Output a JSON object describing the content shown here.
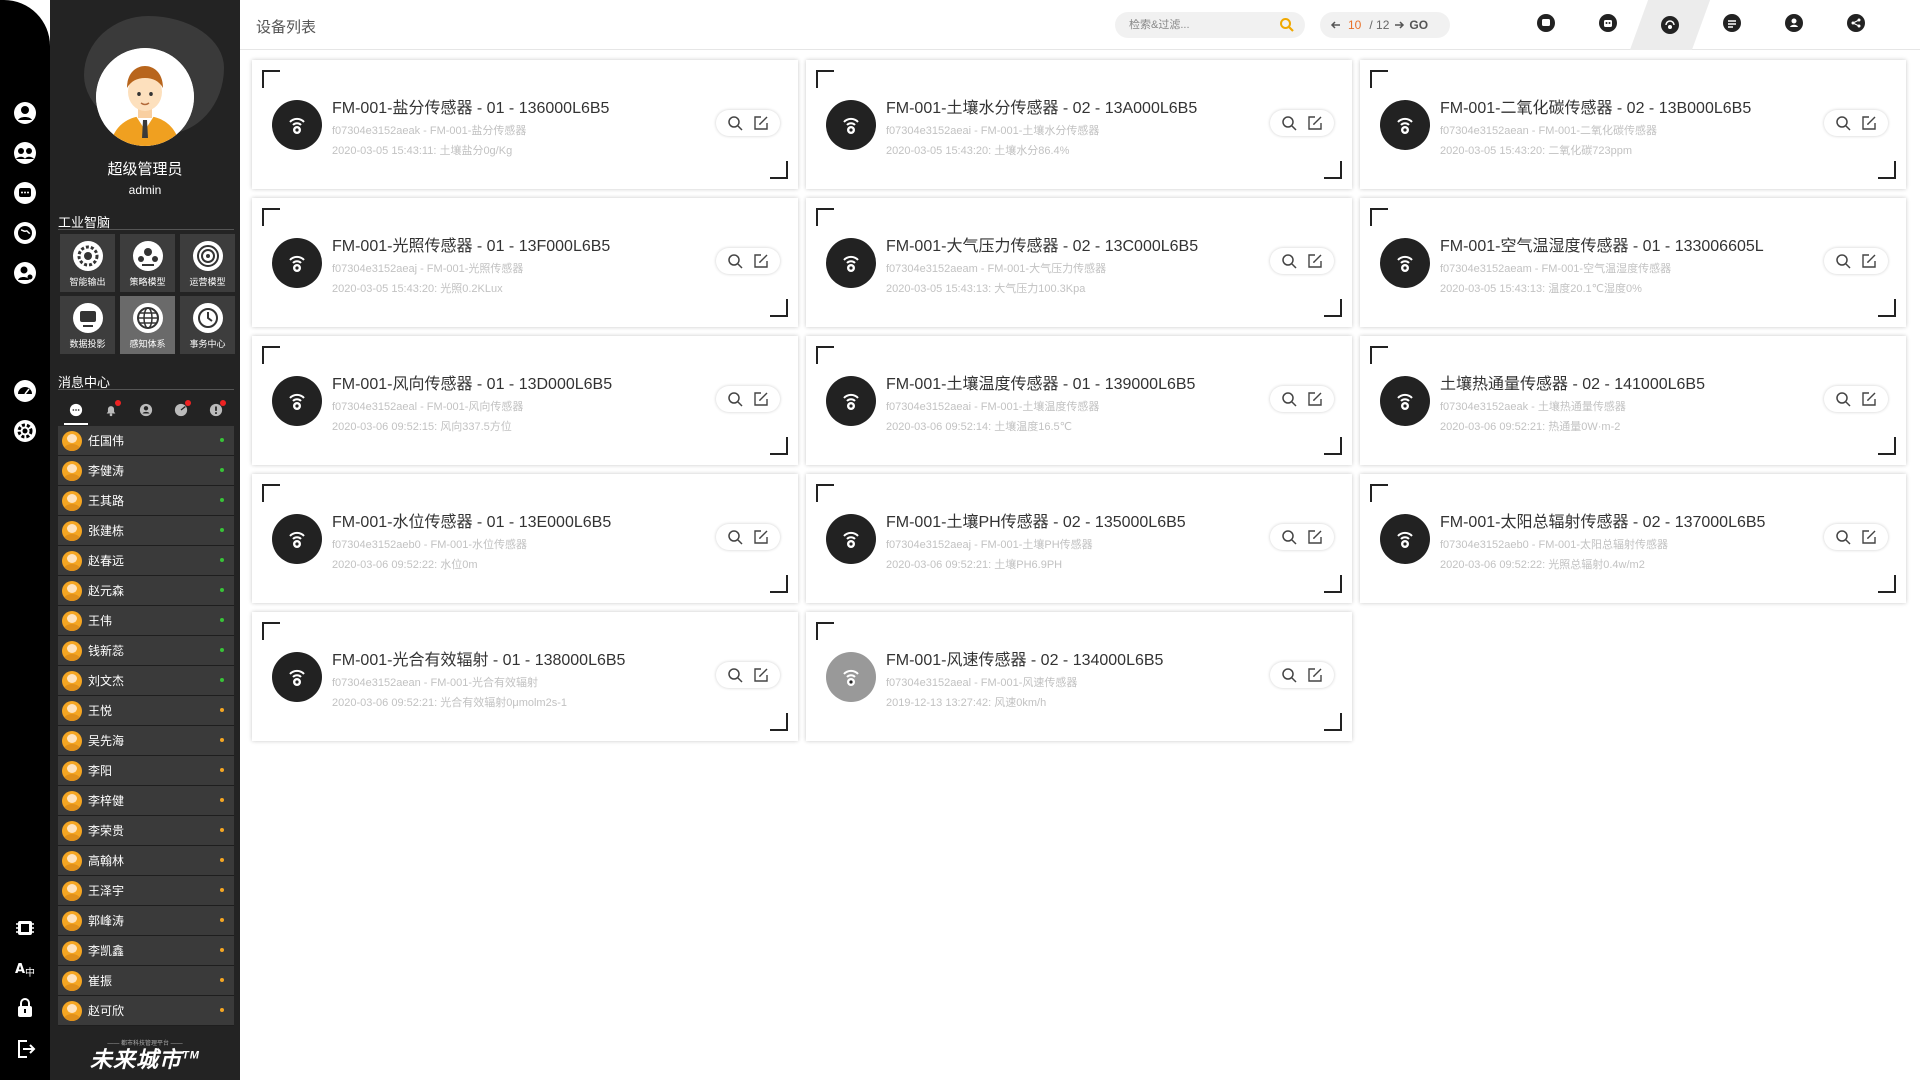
{
  "page_title": "设备列表",
  "search": {
    "placeholder": "检索&过滤..."
  },
  "pager": {
    "current": "10",
    "total": "/ 12",
    "go": "GO"
  },
  "profile": {
    "display_name": "超级管理员",
    "account": "admin"
  },
  "section_industry": "工业智脑",
  "modules": [
    {
      "label": "智能输出",
      "icon": "gear-icon",
      "active": false
    },
    {
      "label": "策略模型",
      "icon": "model-icon",
      "active": false
    },
    {
      "label": "运营模型",
      "icon": "operation-icon",
      "active": false
    },
    {
      "label": "数据投影",
      "icon": "projection-icon",
      "active": false
    },
    {
      "label": "感知体系",
      "icon": "globe-icon",
      "active": true
    },
    {
      "label": "事务中心",
      "icon": "affair-icon",
      "active": false
    }
  ],
  "section_messages": "消息中心",
  "contacts": [
    {
      "name": "任国伟",
      "status": "online"
    },
    {
      "name": "李健涛",
      "status": "online"
    },
    {
      "name": "王其路",
      "status": "online"
    },
    {
      "name": "张建栋",
      "status": "online"
    },
    {
      "name": "赵春远",
      "status": "online"
    },
    {
      "name": "赵元森",
      "status": "online"
    },
    {
      "name": "王伟",
      "status": "online"
    },
    {
      "name": "钱新蕊",
      "status": "online"
    },
    {
      "name": "刘文杰",
      "status": "online"
    },
    {
      "name": "王悦",
      "status": "away"
    },
    {
      "name": "吴先海",
      "status": "away"
    },
    {
      "name": "李阳",
      "status": "away"
    },
    {
      "name": "李梓健",
      "status": "away"
    },
    {
      "name": "李荣贵",
      "status": "away"
    },
    {
      "name": "高翰林",
      "status": "away"
    },
    {
      "name": "王泽宇",
      "status": "away"
    },
    {
      "name": "郭峰涛",
      "status": "away"
    },
    {
      "name": "李凯鑫",
      "status": "away"
    },
    {
      "name": "崔振",
      "status": "away"
    },
    {
      "name": "赵可欣",
      "status": "away"
    }
  ],
  "logo": {
    "text": "未来城市",
    "tm": "TM",
    "small": "—— 都市科技管理平台 ——"
  },
  "colors": {
    "online": "#38c238",
    "away": "#f5a623",
    "accent": "#e8712a",
    "search_icon": "#f0a800"
  },
  "devices": [
    {
      "name": "FM-001-盐分传感器 - 01 - 136000L6B5",
      "sub": "f07304e3152aeak - FM-001-盐分传感器",
      "time": "2020-03-05 15:43:11: 土壤盐分0g/Kg",
      "online": true
    },
    {
      "name": "FM-001-土壤水分传感器 - 02 - 13A000L6B5",
      "sub": "f07304e3152aeai - FM-001-土壤水分传感器",
      "time": "2020-03-05 15:43:20: 土壤水分86.4%",
      "online": true
    },
    {
      "name": "FM-001-二氧化碳传感器 - 02 - 13B000L6B5",
      "sub": "f07304e3152aean - FM-001-二氧化碳传感器",
      "time": "2020-03-05 15:43:20: 二氧化碳723ppm",
      "online": true
    },
    {
      "name": "FM-001-光照传感器 - 01 - 13F000L6B5",
      "sub": "f07304e3152aeaj - FM-001-光照传感器",
      "time": "2020-03-05 15:43:20: 光照0.2KLux",
      "online": true
    },
    {
      "name": "FM-001-大气压力传感器 - 02 - 13C000L6B5",
      "sub": "f07304e3152aeam - FM-001-大气压力传感器",
      "time": "2020-03-05 15:43:13: 大气压力100.3Kpa",
      "online": true
    },
    {
      "name": "FM-001-空气温湿度传感器 - 01 - 133006605L",
      "sub": "f07304e3152aeam - FM-001-空气温湿度传感器",
      "time": "2020-03-05 15:43:13: 温度20.1℃湿度0%",
      "online": true
    },
    {
      "name": "FM-001-风向传感器 - 01 - 13D000L6B5",
      "sub": "f07304e3152aeal - FM-001-风向传感器",
      "time": "2020-03-06 09:52:15: 风向337.5方位",
      "online": true
    },
    {
      "name": "FM-001-土壤温度传感器 - 01 - 139000L6B5",
      "sub": "f07304e3152aeai - FM-001-土壤温度传感器",
      "time": "2020-03-06 09:52:14: 土壤温度16.5℃",
      "online": true
    },
    {
      "name": "土壤热通量传感器 - 02 - 141000L6B5",
      "sub": "f07304e3152aeak - 土壤热通量传感器",
      "time": "2020-03-06 09:52:21: 热通量0W·m-2",
      "online": true
    },
    {
      "name": "FM-001-水位传感器 - 01 - 13E000L6B5",
      "sub": "f07304e3152aeb0 - FM-001-水位传感器",
      "time": "2020-03-06 09:52:22: 水位0m",
      "online": true
    },
    {
      "name": "FM-001-土壤PH传感器 - 02 - 135000L6B5",
      "sub": "f07304e3152aeaj - FM-001-土壤PH传感器",
      "time": "2020-03-06 09:52:21: 土壤PH6.9PH",
      "online": true
    },
    {
      "name": "FM-001-太阳总辐射传感器 - 02 - 137000L6B5",
      "sub": "f07304e3152aeb0 - FM-001-太阳总辐射传感器",
      "time": "2020-03-06 09:52:22: 光照总辐射0.4w/m2",
      "online": true
    },
    {
      "name": "FM-001-光合有效辐射 - 01 - 138000L6B5",
      "sub": "f07304e3152aean - FM-001-光合有效辐射",
      "time": "2020-03-06 09:52:21: 光合有效辐射0μmolm2s-1",
      "online": true
    },
    {
      "name": "FM-001-风速传感器 - 02 - 134000L6B5",
      "sub": "f07304e3152aeal - FM-001-风速传感器",
      "time": "2019-12-13 13:27:42: 风速0km/h",
      "online": false
    }
  ]
}
